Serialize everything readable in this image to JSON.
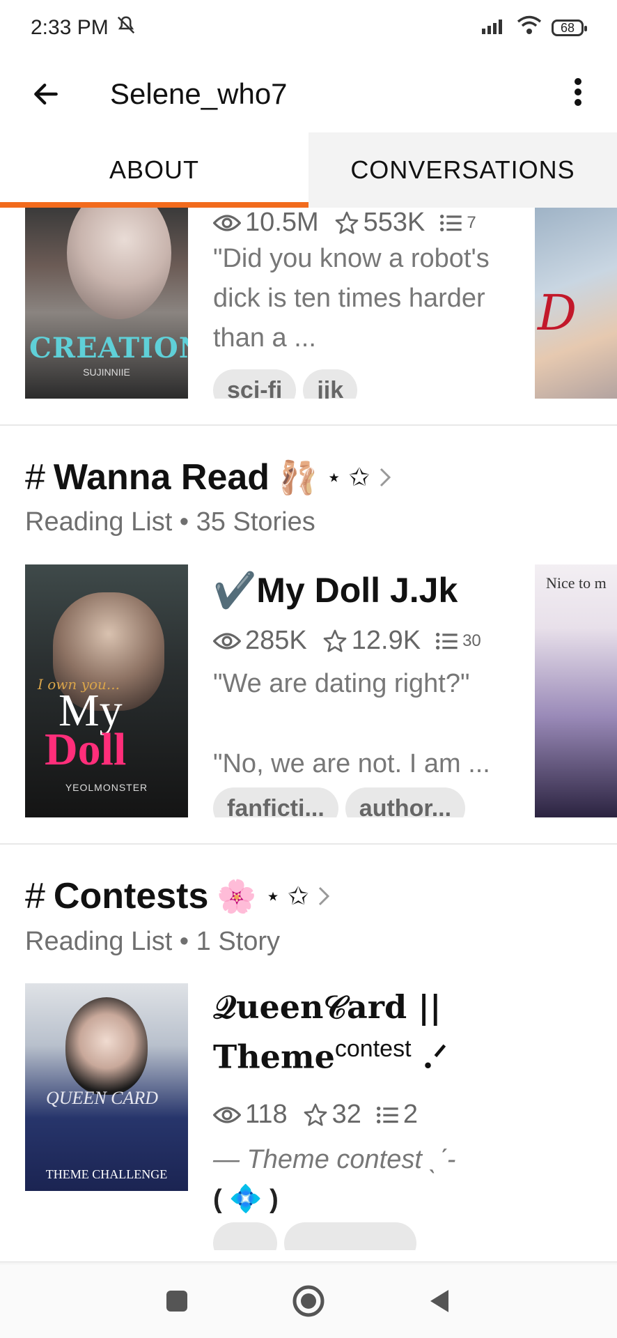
{
  "status": {
    "time": "2:33 PM",
    "battery": "68"
  },
  "header": {
    "title": "Selene_who7"
  },
  "tabs": [
    {
      "label": "ABOUT"
    },
    {
      "label": "CONVERSATIONS"
    }
  ],
  "top_story": {
    "views": "10.5M",
    "votes": "553K",
    "parts": "7",
    "description": "\"Did you know a robot's dick is ten times harder than a ...",
    "tags": [
      "sci-fi",
      "jjk"
    ],
    "cover_text": "CREATION",
    "cover_author": "SUJINNIIE"
  },
  "lists": [
    {
      "title": "Wanna Read",
      "emoji": "🩰",
      "sparkles": "⋆ ✩",
      "subtitle": "Reading List • 35 Stories",
      "story": {
        "title_prefix": "✔️",
        "title": "My Doll J.Jk",
        "views": "285K",
        "votes": "12.9K",
        "parts": "30",
        "description_1": "\"We are dating right?\"",
        "description_2": "\"No, we are not. I am ...",
        "tags": [
          "fanficti...",
          "author..."
        ],
        "cover_top": "I own you...",
        "cover_my": "My",
        "cover_doll": "Doll",
        "cover_author": "YEOLMONSTER"
      },
      "peek_text": "Nice to m"
    },
    {
      "title": "Contests",
      "emoji": "🌸",
      "sparkles": "⋆ ✩",
      "subtitle": "Reading List • 1 Story",
      "story": {
        "title_line1": "𝒬ueen𝒞ard ||",
        "title_line2": "Theme",
        "title_sup": "contest",
        "title_tail": " .ᐟ",
        "views": "118",
        "votes": "32",
        "parts": "2",
        "description_1": "— Theme contest ˎˊ-",
        "description_2": "( 💠 )",
        "cover_text": "QUEEN CARD",
        "cover_sub": "THEME CHALLENGE"
      }
    }
  ],
  "icons": {
    "back": "arrow-left-icon",
    "more": "more-vertical-icon",
    "views": "eye-icon",
    "votes": "star-icon",
    "parts": "list-icon",
    "hash": "hash-icon",
    "chevron": "chevron-right-icon"
  },
  "colors": {
    "accent": "#f26b1d"
  }
}
